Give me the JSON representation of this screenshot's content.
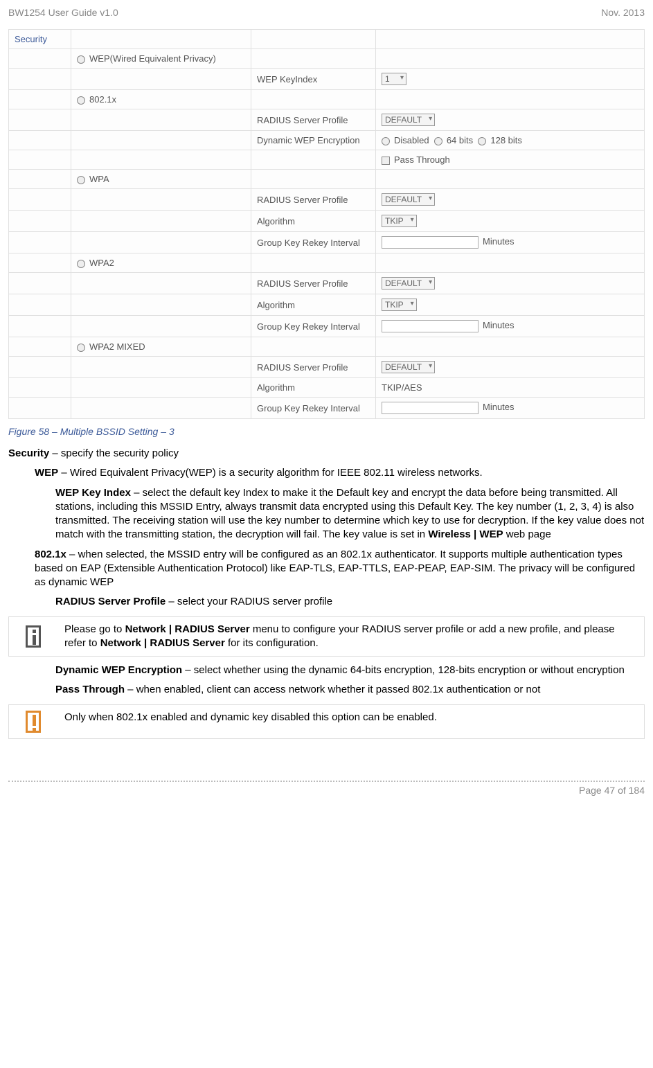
{
  "header": {
    "doc_title": "BW1254 User Guide v1.0",
    "doc_date": "Nov.  2013"
  },
  "table": {
    "security_label": "Security",
    "wep_label": "WEP(Wired Equivalent Privacy)",
    "wep_keyindex_label": "WEP KeyIndex",
    "wep_keyindex_value": "1",
    "dot1x_label": "802.1x",
    "radius_profile_label": "RADIUS Server Profile",
    "radius_profile_value": "DEFAULT",
    "dyn_wep_label": "Dynamic WEP Encryption",
    "dyn_wep_disabled": "Disabled",
    "dyn_wep_64": "64 bits",
    "dyn_wep_128": "128 bits",
    "pass_through_label": "Pass Through",
    "wpa_label": "WPA",
    "algorithm_label": "Algorithm",
    "algorithm_value": "TKIP",
    "rekey_label": "Group Key Rekey Interval",
    "minutes_label": "Minutes",
    "wpa2_label": "WPA2",
    "wpa2mixed_label": "WPA2 MIXED",
    "tkip_aes_value": "TKIP/AES"
  },
  "caption": "Figure 58 – Multiple BSSID Setting – 3",
  "body": {
    "security_intro_b": "Security",
    "security_intro_rest": " – specify the security policy",
    "wep_b": "WEP",
    "wep_rest": " – Wired Equivalent Privacy(WEP) is a security algorithm for IEEE 802.11 wireless networks.",
    "wepkey_b": "WEP Key Index",
    "wepkey_rest_1": " – select the default key Index to make it the Default key and encrypt the data before being transmitted. All stations, including this MSSID Entry, always transmit data encrypted using this Default Key. The key number (1, 2, 3, 4) is also transmitted. The receiving station will use the key number to determine which key to use for decryption. If the key value does not match with the transmitting station, the decryption will fail. The key value is set in ",
    "wepkey_b2": "Wireless | WEP",
    "wepkey_rest_2": " web page",
    "dot1x_b": "802.1x",
    "dot1x_rest": " – when selected, the MSSID entry will be configured as an 802.1x authenticator. It supports multiple authentication types based on EAP (Extensible Authentication Protocol) like EAP-TLS, EAP-TTLS, EAP-PEAP, EAP-SIM. The privacy will be configured as dynamic WEP",
    "radius_b": "RADIUS Server Profile",
    "radius_rest": " – select your RADIUS server profile",
    "note1_pre": "Please go to ",
    "note1_b1": "Network | RADIUS Server",
    "note1_mid": " menu to configure your RADIUS server profile or add a new profile, and please refer to ",
    "note1_b2": "Network | RADIUS Server",
    "note1_end": " for its configuration.",
    "dynwep_b": "Dynamic WEP Encryption",
    "dynwep_rest": " – select whether using the dynamic 64-bits encryption, 128-bits encryption or without encryption",
    "pass_b": "Pass Through",
    "pass_rest": " – when enabled, client can access network whether it passed 802.1x authentication or not",
    "note2_text": "Only when 802.1x enabled and dynamic key disabled this option can be enabled."
  },
  "footer": {
    "page_of": "Page 47 of 184"
  }
}
